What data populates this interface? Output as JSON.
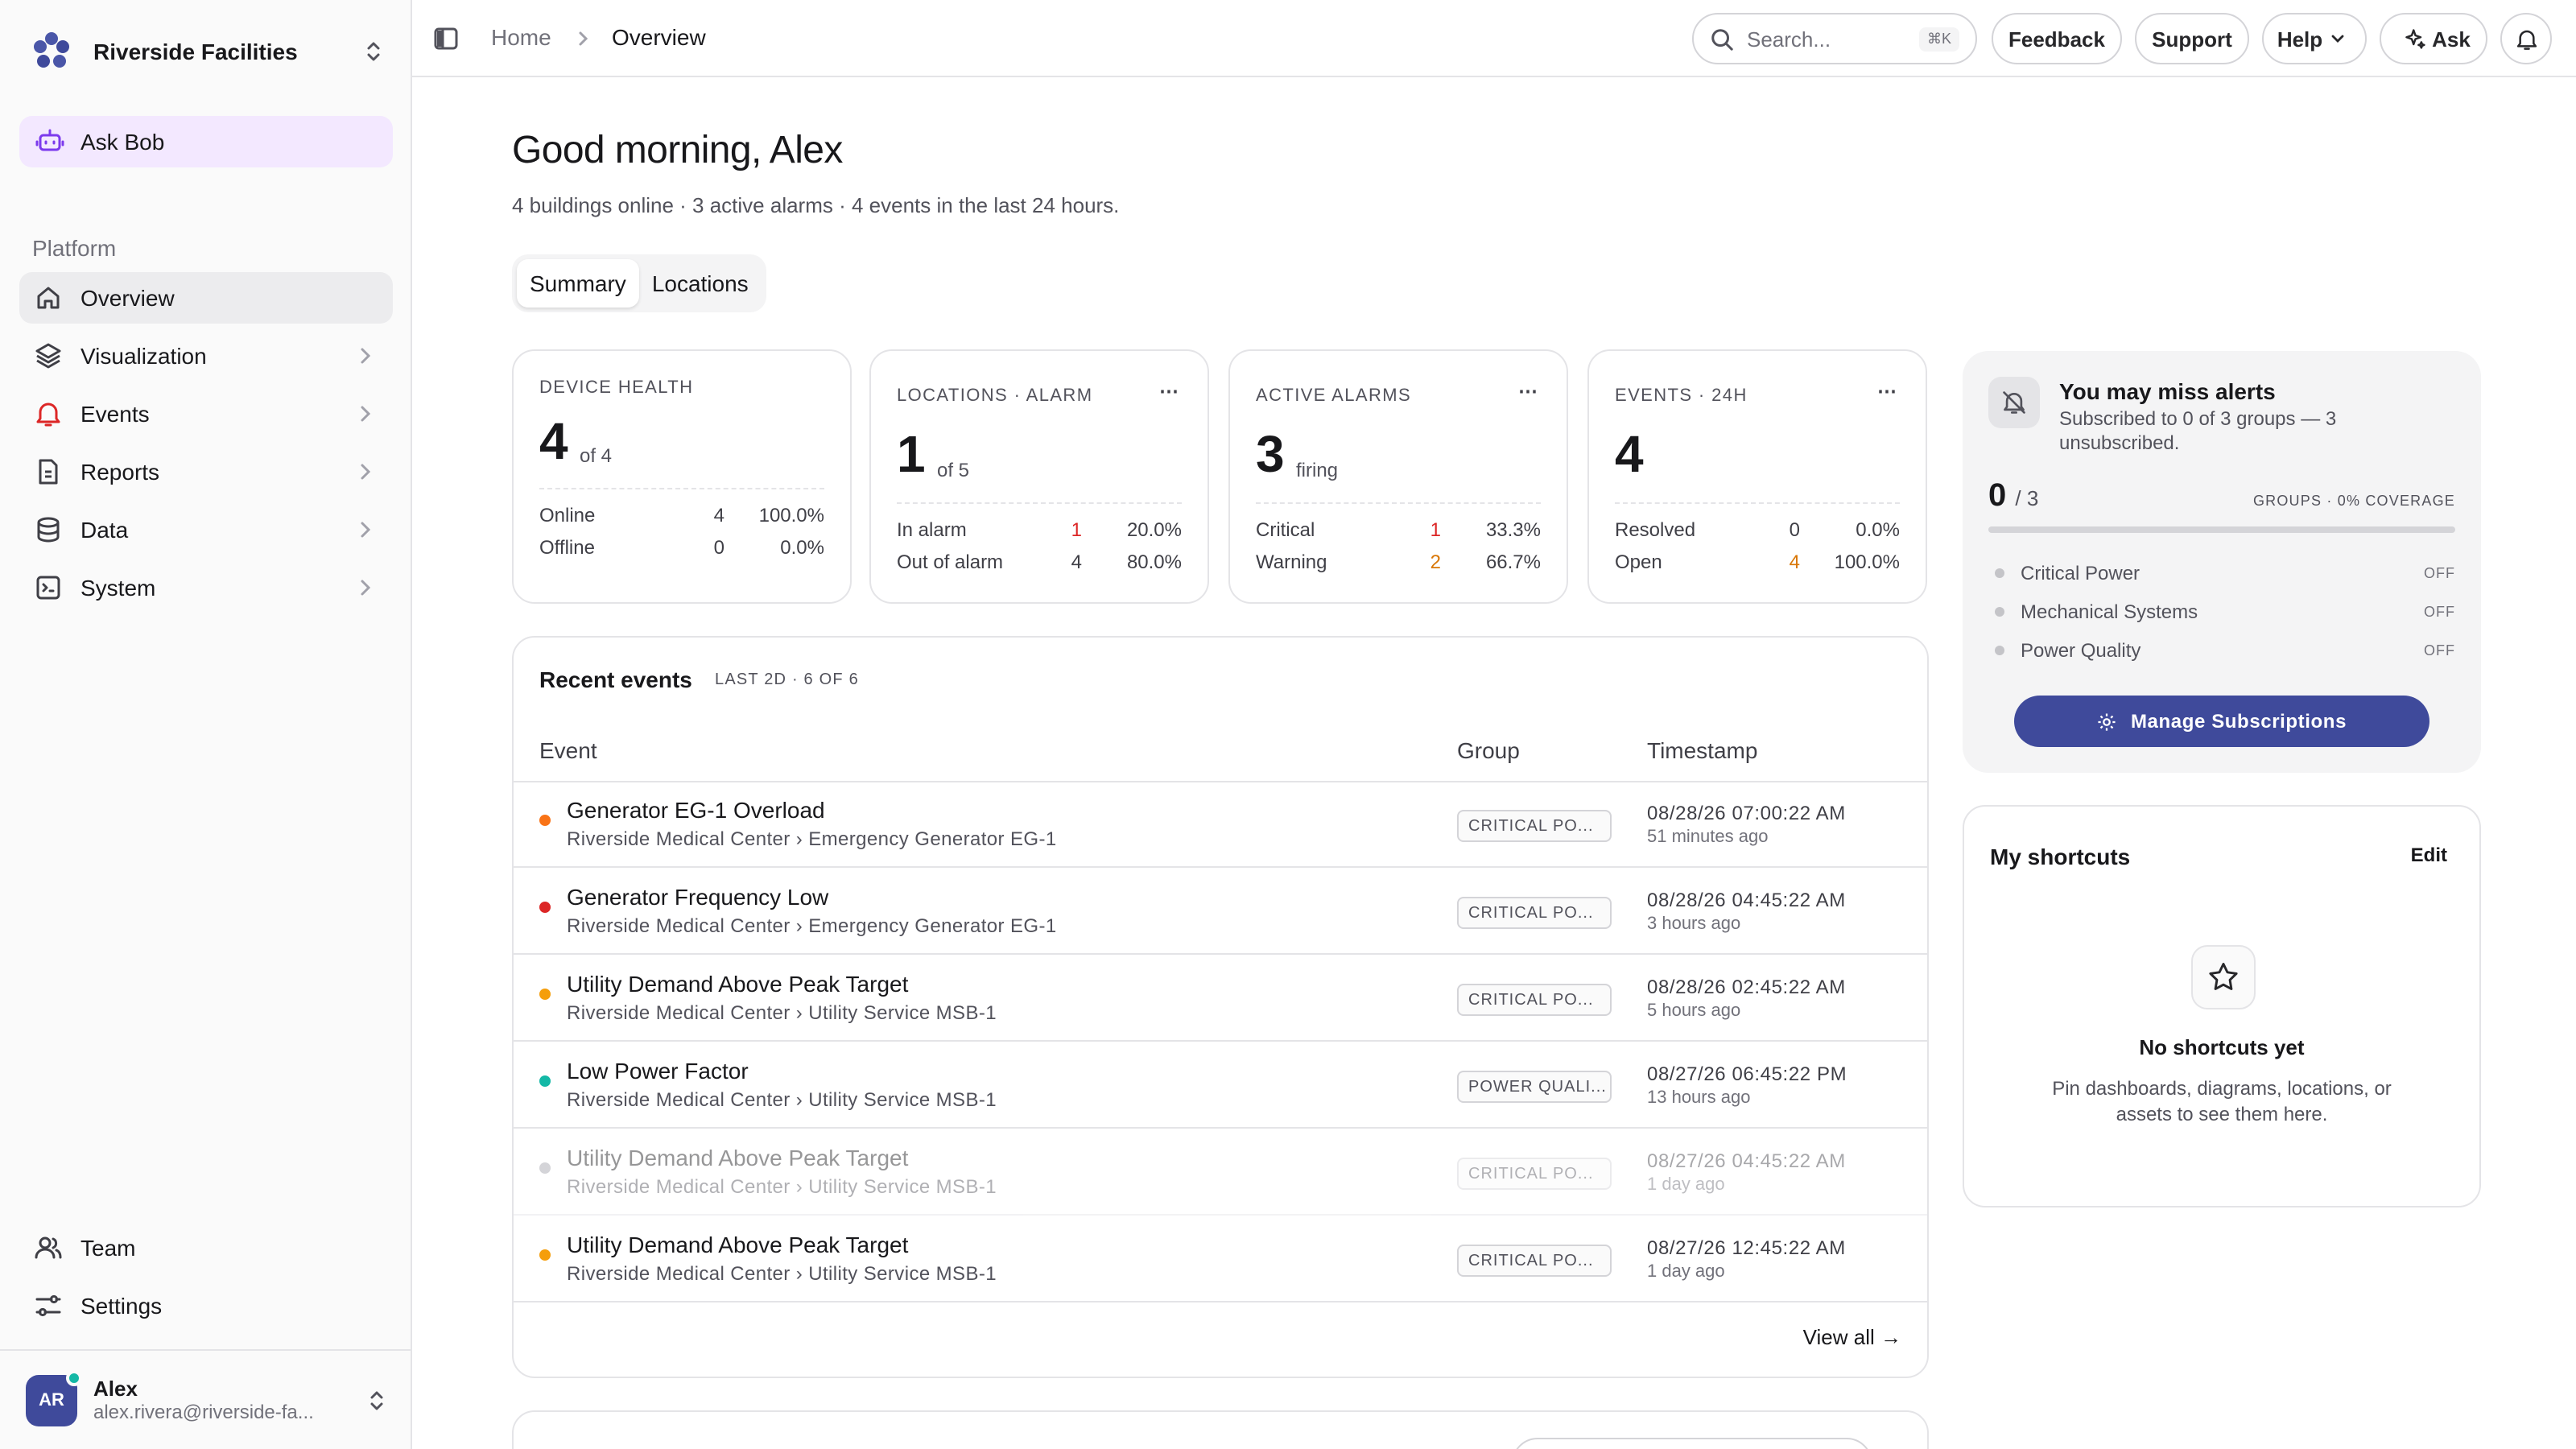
{
  "brand": {
    "name": "Riverside Facilities"
  },
  "sidebar": {
    "ask_bob": "Ask Bob",
    "section_label": "Platform",
    "items": [
      {
        "label": "Overview",
        "icon": "home-icon"
      },
      {
        "label": "Visualization",
        "icon": "layers-icon"
      },
      {
        "label": "Events",
        "icon": "bell-icon"
      },
      {
        "label": "Reports",
        "icon": "file-icon"
      },
      {
        "label": "Data",
        "icon": "database-icon"
      },
      {
        "label": "System",
        "icon": "terminal-icon"
      }
    ],
    "bottom_items": [
      {
        "label": "Team",
        "icon": "users-icon"
      },
      {
        "label": "Settings",
        "icon": "sliders-icon"
      }
    ],
    "user": {
      "initials": "AR",
      "name": "Alex",
      "email": "alex.rivera@riverside-fa..."
    }
  },
  "topbar": {
    "breadcrumb": [
      "Home",
      "Overview"
    ],
    "search_placeholder": "Search...",
    "search_shortcut": "⌘K",
    "feedback": "Feedback",
    "support": "Support",
    "help": "Help",
    "ask": "Ask"
  },
  "greeting": {
    "title": "Good morning, Alex",
    "subtitle": "4 buildings online · 3 active alarms · 4 events in the last 24 hours."
  },
  "tabs": [
    "Summary",
    "Locations"
  ],
  "stats": [
    {
      "label": "DEVICE HEALTH",
      "value": "4",
      "of": "of 4",
      "rows": [
        {
          "name": "Online",
          "count": "4",
          "pct": "100.0%"
        },
        {
          "name": "Offline",
          "count": "0",
          "pct": "0.0%"
        }
      ]
    },
    {
      "label": "LOCATIONS · ALARM",
      "value": "1",
      "of": "of 5",
      "rows": [
        {
          "name": "In alarm",
          "count": "1",
          "pct": "20.0%"
        },
        {
          "name": "Out of alarm",
          "count": "4",
          "pct": "80.0%"
        }
      ]
    },
    {
      "label": "ACTIVE ALARMS",
      "value": "3",
      "of": "firing",
      "rows": [
        {
          "name": "Critical",
          "count": "1",
          "pct": "33.3%"
        },
        {
          "name": "Warning",
          "count": "2",
          "pct": "66.7%"
        }
      ]
    },
    {
      "label": "EVENTS · 24H",
      "value": "4",
      "of": "",
      "rows": [
        {
          "name": "Resolved",
          "count": "0",
          "pct": "0.0%"
        },
        {
          "name": "Open",
          "count": "4",
          "pct": "100.0%"
        }
      ]
    }
  ],
  "recent_events": {
    "title": "Recent events",
    "meta": "LAST 2D · 6 OF 6",
    "columns": [
      "Event",
      "Group",
      "Timestamp"
    ],
    "rows": [
      {
        "name": "Generator EG-1 Overload",
        "path": "Riverside Medical Center › Emergency Generator EG-1",
        "group": "CRITICAL PO...",
        "timestamp": "08/28/26 07:00:22 AM",
        "ago": "51 minutes ago",
        "dot": "#f97316"
      },
      {
        "name": "Generator Frequency Low",
        "path": "Riverside Medical Center › Emergency Generator EG-1",
        "group": "CRITICAL PO...",
        "timestamp": "08/28/26 04:45:22 AM",
        "ago": "3 hours ago",
        "dot": "#dc2626"
      },
      {
        "name": "Utility Demand Above Peak Target",
        "path": "Riverside Medical Center › Utility Service MSB-1",
        "group": "CRITICAL PO...",
        "timestamp": "08/28/26 02:45:22 AM",
        "ago": "5 hours ago",
        "dot": "#f59e0b"
      },
      {
        "name": "Low Power Factor",
        "path": "Riverside Medical Center › Utility Service MSB-1",
        "group": "POWER QUALI...",
        "timestamp": "08/27/26 06:45:22 PM",
        "ago": "13 hours ago",
        "dot": "#14b8a6"
      },
      {
        "name": "Utility Demand Above Peak Target",
        "path": "Riverside Medical Center › Utility Service MSB-1",
        "group": "CRITICAL PO...",
        "timestamp": "08/27/26 04:45:22 AM",
        "ago": "1 day ago",
        "dot": "#a1a1aa"
      },
      {
        "name": "Utility Demand Above Peak Target",
        "path": "Riverside Medical Center › Utility Service MSB-1",
        "group": "CRITICAL PO...",
        "timestamp": "08/27/26 12:45:22 AM",
        "ago": "1 day ago",
        "dot": "#f59e0b"
      }
    ],
    "view_all": "View all →"
  },
  "alerts": {
    "title": "You may miss alerts",
    "subtitle": "Subscribed to 0 of 3 groups — 3 unsubscribed.",
    "count": "0",
    "total": "/ 3",
    "coverage": "GROUPS · 0% COVERAGE",
    "coverage_fraction": 0,
    "groups": [
      {
        "name": "Critical Power",
        "status": "OFF"
      },
      {
        "name": "Mechanical Systems",
        "status": "OFF"
      },
      {
        "name": "Power Quality",
        "status": "OFF"
      }
    ],
    "manage": "Manage Subscriptions"
  },
  "shortcuts": {
    "title": "My shortcuts",
    "edit": "Edit",
    "empty_title": "No shortcuts yet",
    "empty_desc": "Pin dashboards, diagrams, locations, or assets to see them here."
  },
  "colors": {
    "accent": "#3f4a9b",
    "ask_bob_bg": "#f3e8ff",
    "critical": "#dc2626",
    "warning": "#d97706",
    "online": "#14b8a6"
  }
}
